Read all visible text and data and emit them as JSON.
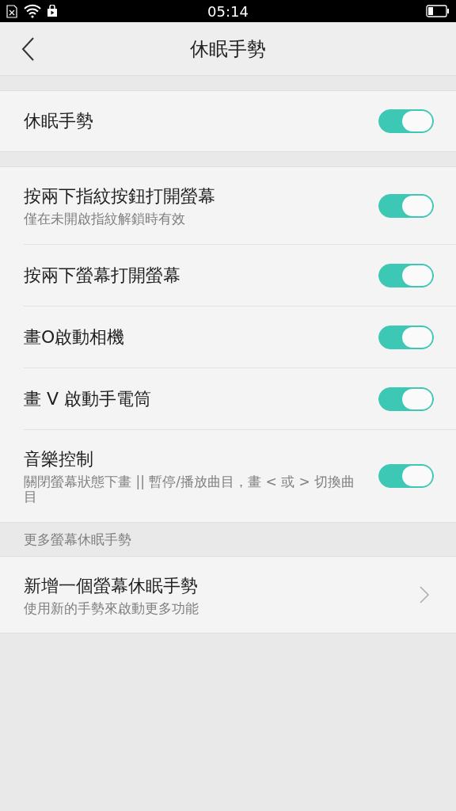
{
  "status_bar": {
    "time": "05:14"
  },
  "header": {
    "title": "休眠手勢"
  },
  "main_toggle": {
    "label": "休眠手勢",
    "on": true
  },
  "gestures": [
    {
      "label": "按兩下指紋按鈕打開螢幕",
      "description": "僅在未開啟指紋解鎖時有效",
      "on": true
    },
    {
      "label": "按兩下螢幕打開螢幕",
      "on": true
    },
    {
      "label": "畫O啟動相機",
      "on": true
    },
    {
      "label": "畫 V 啟動手電筒",
      "on": true
    },
    {
      "label": "音樂控制",
      "description": "關閉螢幕狀態下畫 || 暫停/播放曲目，畫 < 或 > 切換曲目",
      "on": true
    }
  ],
  "more_section": {
    "header": "更多螢幕休眠手勢",
    "items": [
      {
        "label": "新增一個螢幕休眠手勢",
        "description": "使用新的手勢來啟動更多功能"
      }
    ]
  }
}
